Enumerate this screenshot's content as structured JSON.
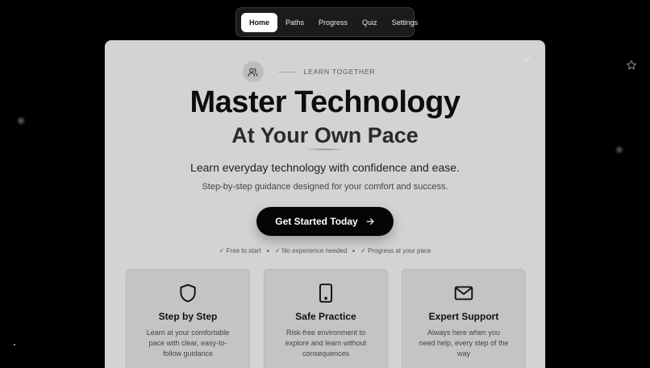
{
  "nav": {
    "items": [
      {
        "label": "Home",
        "active": true
      },
      {
        "label": "Paths"
      },
      {
        "label": "Progress"
      },
      {
        "label": "Quiz"
      },
      {
        "label": "Settings"
      }
    ]
  },
  "hero": {
    "badge_icon": "users-icon",
    "badge_text": "LEARN TOGETHER",
    "title": "Master Technology",
    "subtitle": "At Your Own Pace",
    "lead": "Learn everyday technology with confidence and ease.",
    "sub_lead": "Step-by-step guidance designed for your comfort and success.",
    "cta_label": "Get Started Today",
    "cta_icon": "arrow-right-icon",
    "perks": [
      "✓ Free to start",
      "✓ No experience needed",
      "✓ Progress at your pace"
    ]
  },
  "features": [
    {
      "icon": "shield-icon",
      "title": "Step by Step",
      "desc": "Learn at your comfortable pace with clear, easy-to-follow guidance"
    },
    {
      "icon": "tablet-icon",
      "title": "Safe Practice",
      "desc": "Risk-free environment to explore and learn without consequences"
    },
    {
      "icon": "mail-icon",
      "title": "Expert Support",
      "desc": "Always here when you need help, every step of the way"
    }
  ],
  "colors": {
    "background": "#000000",
    "card": "#d3d3d3",
    "accent": "#050505"
  }
}
